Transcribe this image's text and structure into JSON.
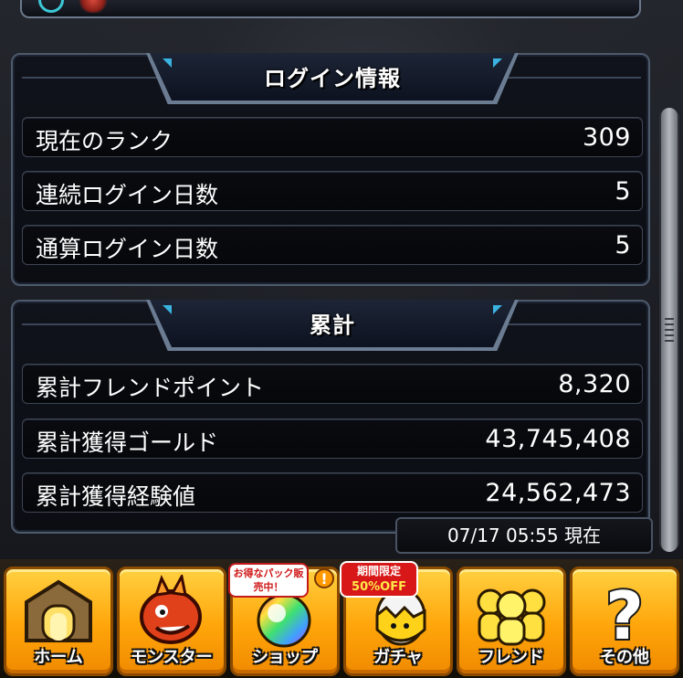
{
  "login_panel": {
    "title": "ログイン情報",
    "rows": [
      {
        "label": "現在のランク",
        "value": "309"
      },
      {
        "label": "連続ログイン日数",
        "value": "5"
      },
      {
        "label": "通算ログイン日数",
        "value": "5"
      }
    ]
  },
  "total_panel": {
    "title": "累計",
    "rows": [
      {
        "label": "累計フレンドポイント",
        "value": "8,320"
      },
      {
        "label": "累計獲得ゴールド",
        "value": "43,745,408"
      },
      {
        "label": "累計獲得経験値",
        "value": "24,562,473"
      }
    ]
  },
  "timestamp": "07/17 05:55 現在",
  "nav": {
    "items": [
      {
        "label": "ホーム",
        "icon": "home-gate-icon"
      },
      {
        "label": "モンスター",
        "icon": "red-dragon-monster-icon"
      },
      {
        "label": "ショップ",
        "icon": "rainbow-orb-icon"
      },
      {
        "label": "ガチャ",
        "icon": "gacha-egg-icon"
      },
      {
        "label": "フレンド",
        "icon": "friends-silhouette-icon"
      },
      {
        "label": "その他",
        "icon": "question-mark-icon"
      }
    ],
    "shop_badge": "お得なパック販売中！",
    "gacha_badge_top": "期間限定",
    "gacha_badge_bottom": "50%OFF",
    "alert_mark": "!"
  },
  "colors": {
    "nav_button": "#ffa50a",
    "panel_border": "#4d5a6c",
    "header_accent": "#3ab3e0",
    "badge_red": "#d81818"
  }
}
